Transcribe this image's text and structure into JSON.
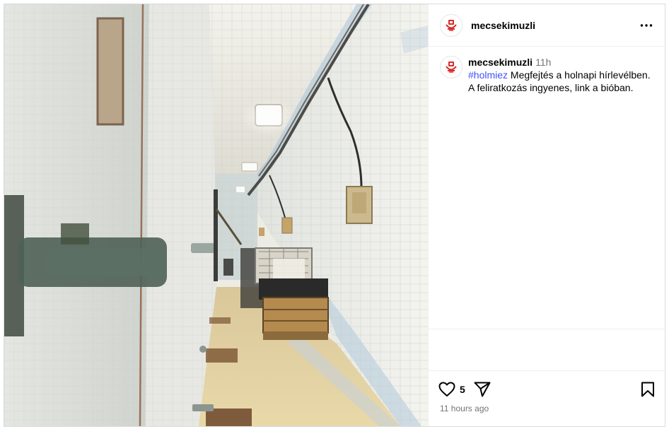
{
  "post": {
    "author": "mecsekimuzli",
    "caption": {
      "username": "mecsekimuzli",
      "time": "11h",
      "hashtag": "#holmiez",
      "text": " Megfejtés a holnapi hírlevélben. A feliratkozás ingyenes, link a bióban."
    },
    "likes": "5",
    "time_ago": "11 hours ago",
    "image_alt": "Tiled underground tunnel corridor with hanging lamps, cables and wooden crates",
    "colors": {
      "hashtag": "#4150f7",
      "avatar_red": "#d82b2b",
      "muted": "#737373"
    },
    "icons": {
      "more": "more-horizontal-icon",
      "like": "heart-icon",
      "share": "send-icon",
      "save": "bookmark-icon",
      "avatar": "museum-logo-icon"
    }
  }
}
